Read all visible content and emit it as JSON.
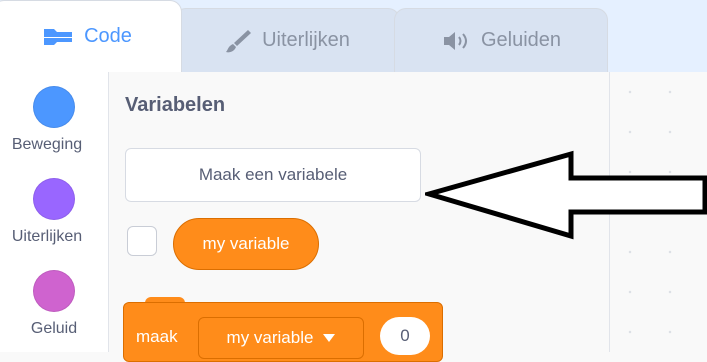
{
  "tabs": {
    "code": "Code",
    "costumes": "Uiterlijken",
    "sounds": "Geluiden"
  },
  "categories": [
    {
      "label": "Beweging",
      "color": "#4c97ff"
    },
    {
      "label": "Uiterlijken",
      "color": "#9966ff"
    },
    {
      "label": "Geluid",
      "color": "#cf63cf"
    }
  ],
  "palette": {
    "section_title": "Variabelen",
    "make_variable_button": "Maak een variabele",
    "variable_reporter": "my variable",
    "set_block": {
      "keyword": "maak",
      "variable": "my variable",
      "value": "0"
    }
  },
  "colors": {
    "accent": "#4c97ff",
    "variables_block": "#ff8c1a",
    "text": "#575e75"
  },
  "icons": {
    "code_tab": "code-blocks-icon",
    "costumes_tab": "paintbrush-icon",
    "sounds_tab": "speaker-icon",
    "dropdown": "caret-down-icon"
  }
}
